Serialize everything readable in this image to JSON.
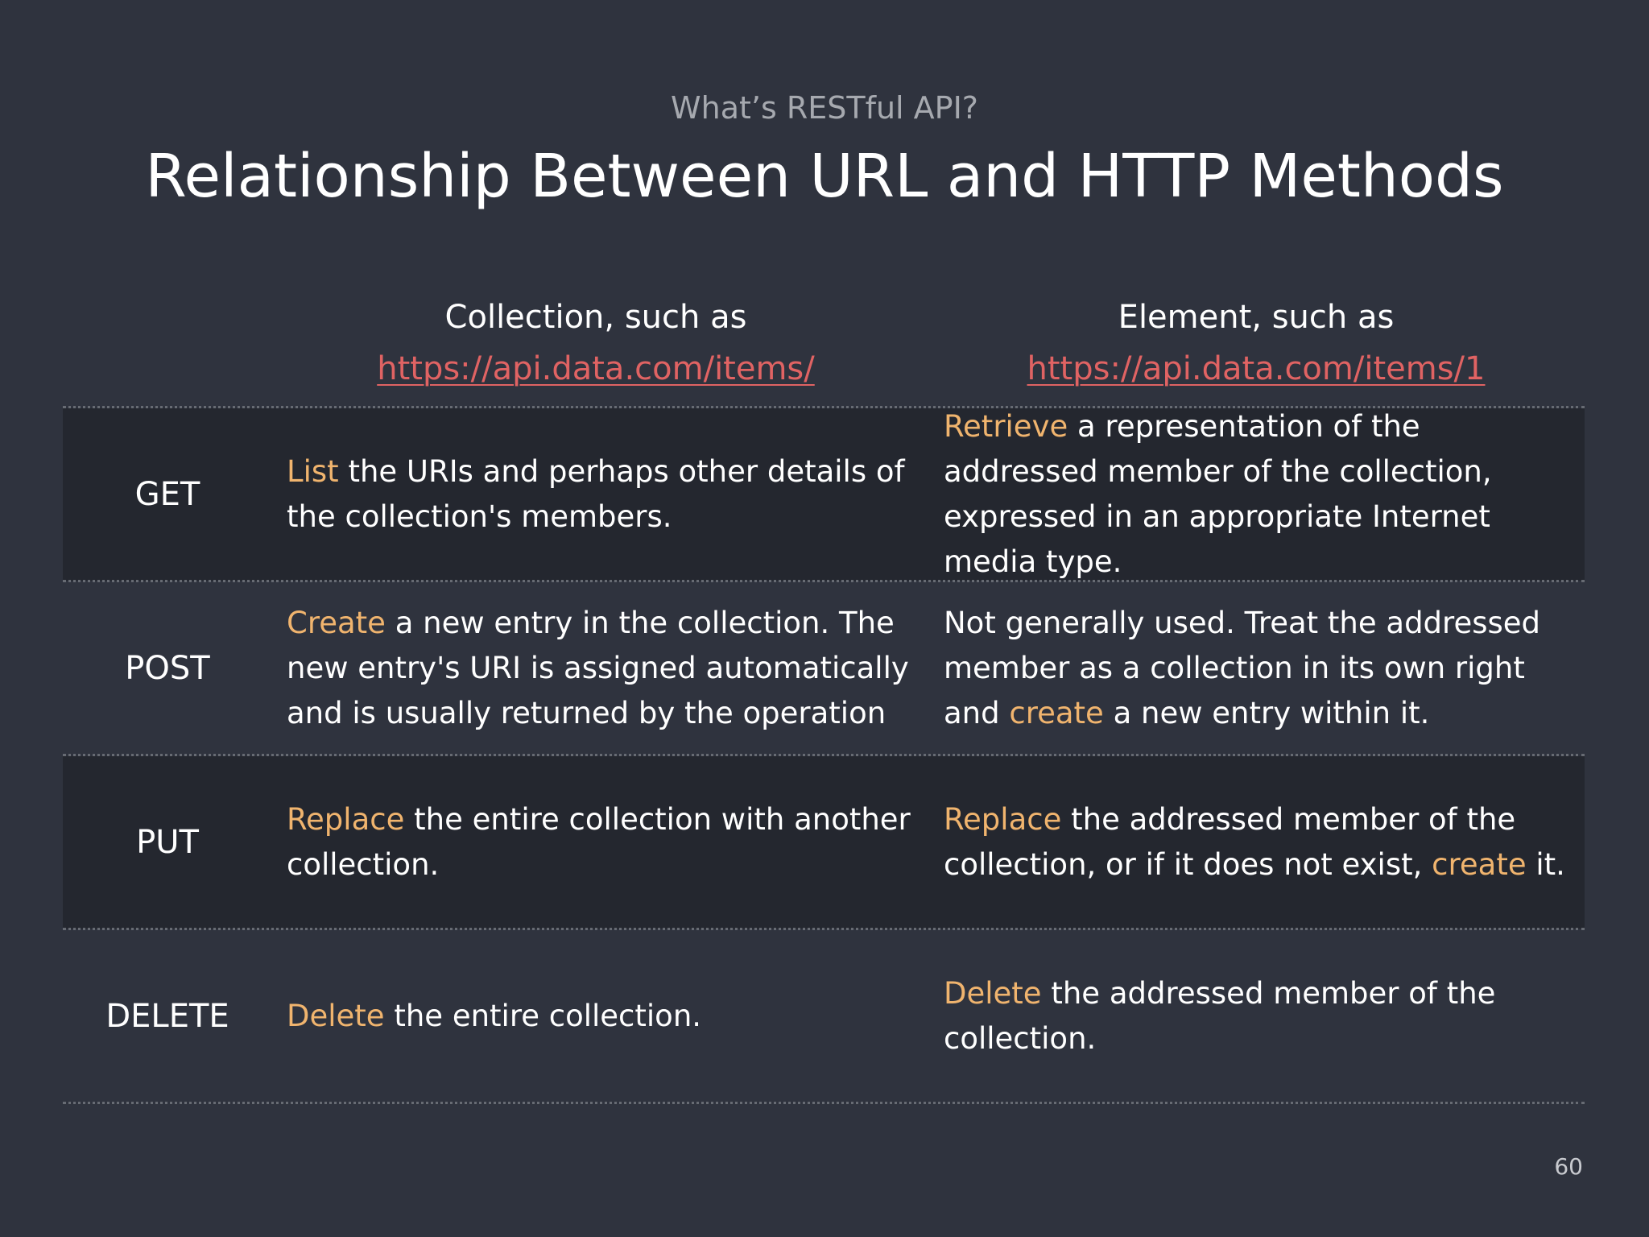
{
  "slide": {
    "subtitle": "What’s RESTful API?",
    "title": "Relationship Between URL and HTTP Methods",
    "page_number": "60"
  },
  "columns": [
    {
      "label": "Collection, such as",
      "url": "https://api.data.com/items/"
    },
    {
      "label": "Element, such as",
      "url": "https://api.data.com/items/1"
    }
  ],
  "rows": [
    {
      "method": "GET",
      "collection": {
        "keyword": "List",
        "rest": " the URIs and perhaps other details of the collection's members."
      },
      "element": {
        "keyword": "Retrieve",
        "rest": " a representation of the addressed member of the collection, expressed in an appropriate Internet media type."
      }
    },
    {
      "method": "POST",
      "collection": {
        "keyword": "Create",
        "rest": " a new entry in the collection. The new entry's URI is assigned automatically and is usually returned by the operation"
      },
      "element": {
        "before": "Not generally used. Treat the addressed member as a collection in its own right and ",
        "keyword": "create",
        "rest": " a new entry within it."
      }
    },
    {
      "method": "PUT",
      "collection": {
        "keyword": "Replace",
        "rest": " the entire collection with another collection."
      },
      "element": {
        "keyword": "Replace",
        "middle": " the addressed member of the collection, or if it does not exist, ",
        "keyword2": "create",
        "rest": " it."
      }
    },
    {
      "method": "DELETE",
      "collection": {
        "keyword": "Delete",
        "rest": " the entire collection."
      },
      "element": {
        "keyword": "Delete",
        "rest": " the addressed member of the collection."
      }
    }
  ],
  "colors": {
    "background": "#2f333e",
    "row_shade": "#24272f",
    "keyword": "#f0b46e",
    "url": "#e06363"
  }
}
